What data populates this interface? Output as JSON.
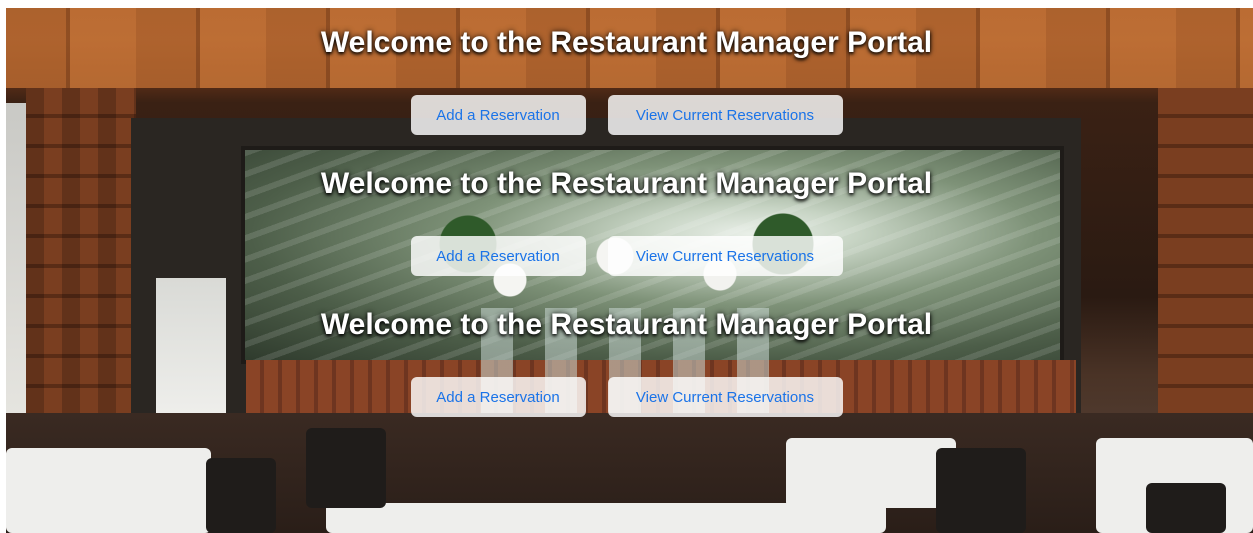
{
  "sections": [
    {
      "title": "Welcome to the Restaurant Manager Portal",
      "add_button": "Add a Reservation",
      "view_button": "View Current Reservations"
    },
    {
      "title": "Welcome to the Restaurant Manager Portal",
      "add_button": "Add a Reservation",
      "view_button": "View Current Reservations"
    },
    {
      "title": "Welcome to the Restaurant Manager Portal",
      "add_button": "Add a Reservation",
      "view_button": "View Current Reservations"
    }
  ],
  "colors": {
    "title_text": "#ffffff",
    "button_text": "#1a73e8",
    "button_bg": "rgba(255,255,255,0.82)"
  },
  "background": {
    "description_icon": "restaurant-dining-room-photo"
  }
}
